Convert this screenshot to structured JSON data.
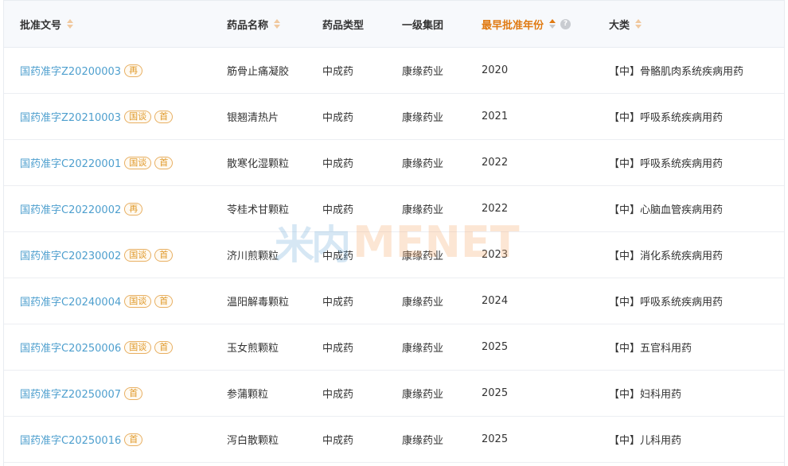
{
  "columns": {
    "approval": "批准文号",
    "name": "药品名称",
    "type": "药品类型",
    "group": "一级集团",
    "year": "最早批准年份",
    "category": "大类"
  },
  "help_icon": "?",
  "watermark": {
    "cn": "米内",
    "en": "MENET"
  },
  "colors": {
    "link": "#4e9fce",
    "accent": "#e07a12",
    "badge": "#e0992a"
  },
  "rows": [
    {
      "approval": "国药准字Z20200003",
      "badges": [
        "再"
      ],
      "name": "筋骨止痛凝胶",
      "type": "中成药",
      "group": "康缘药业",
      "year": "2020",
      "category": "【中】骨骼肌肉系统疾病用药"
    },
    {
      "approval": "国药准字Z20210003",
      "badges": [
        "国谈",
        "首"
      ],
      "name": "银翘清热片",
      "type": "中成药",
      "group": "康缘药业",
      "year": "2021",
      "category": "【中】呼吸系统疾病用药"
    },
    {
      "approval": "国药准字C20220001",
      "badges": [
        "国谈",
        "首"
      ],
      "name": "散寒化湿颗粒",
      "type": "中成药",
      "group": "康缘药业",
      "year": "2022",
      "category": "【中】呼吸系统疾病用药"
    },
    {
      "approval": "国药准字C20220002",
      "badges": [
        "再"
      ],
      "name": "苓桂术甘颗粒",
      "type": "中成药",
      "group": "康缘药业",
      "year": "2022",
      "category": "【中】心脑血管疾病用药"
    },
    {
      "approval": "国药准字C20230002",
      "badges": [
        "国谈",
        "首"
      ],
      "name": "济川煎颗粒",
      "type": "中成药",
      "group": "康缘药业",
      "year": "2023",
      "category": "【中】消化系统疾病用药"
    },
    {
      "approval": "国药准字C20240004",
      "badges": [
        "国谈",
        "首"
      ],
      "name": "温阳解毒颗粒",
      "type": "中成药",
      "group": "康缘药业",
      "year": "2024",
      "category": "【中】呼吸系统疾病用药"
    },
    {
      "approval": "国药准字C20250006",
      "badges": [
        "国谈",
        "首"
      ],
      "name": "玉女煎颗粒",
      "type": "中成药",
      "group": "康缘药业",
      "year": "2025",
      "category": "【中】五官科用药"
    },
    {
      "approval": "国药准字Z20250007",
      "badges": [
        "首"
      ],
      "name": "参蒲颗粒",
      "type": "中成药",
      "group": "康缘药业",
      "year": "2025",
      "category": "【中】妇科用药"
    },
    {
      "approval": "国药准字C20250016",
      "badges": [
        "首"
      ],
      "name": "泻白散颗粒",
      "type": "中成药",
      "group": "康缘药业",
      "year": "2025",
      "category": "【中】儿科用药"
    }
  ]
}
